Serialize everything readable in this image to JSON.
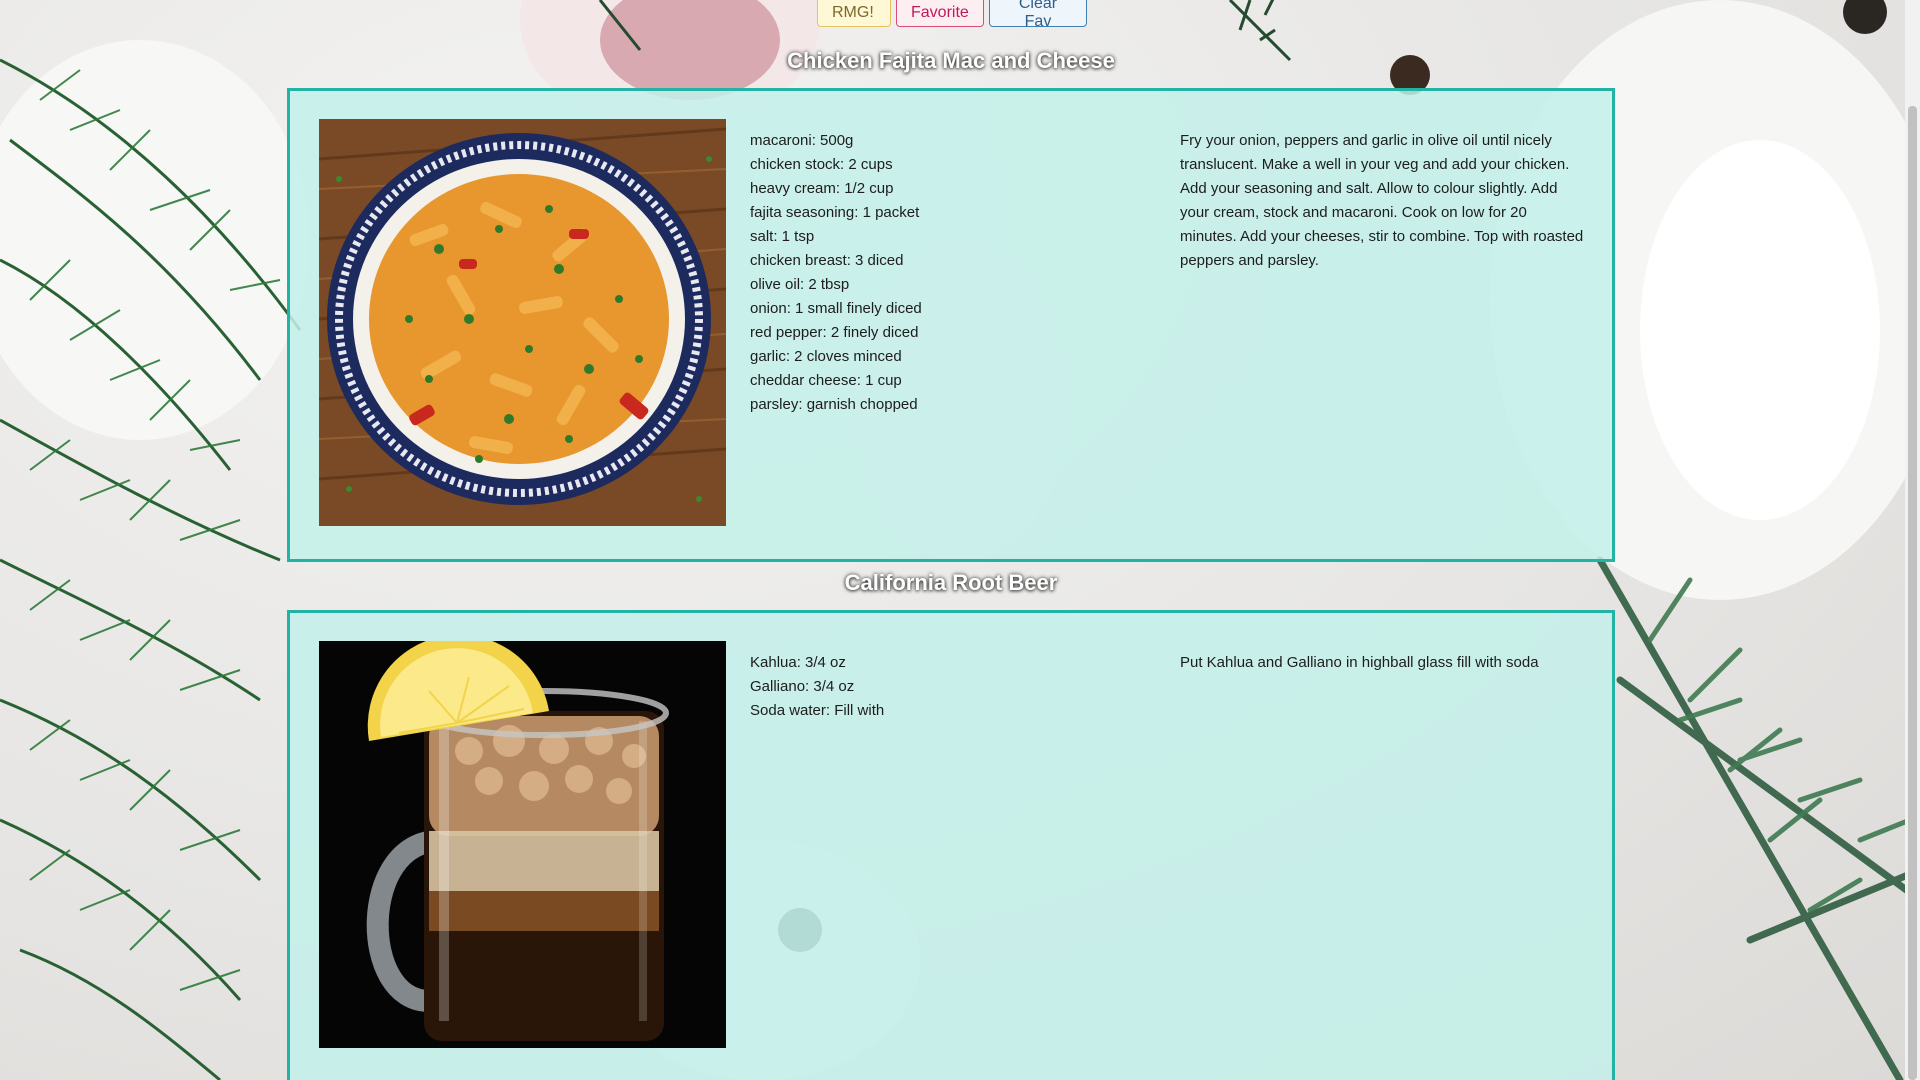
{
  "buttons": {
    "random_label": "RMG!",
    "favorite_label": "Favorite",
    "clear_fav_label": "Clear Fav"
  },
  "recipes": [
    {
      "title": "Chicken Fajita Mac and Cheese",
      "image_icon": "pasta-bowl-photo",
      "ingredients": [
        "macaroni: 500g",
        "chicken stock: 2 cups",
        "heavy cream: 1/2 cup",
        "fajita seasoning: 1 packet",
        "salt: 1 tsp",
        "chicken breast: 3 diced",
        "olive oil: 2 tbsp",
        "onion: 1 small finely diced",
        "red pepper: 2 finely diced",
        "garlic: 2 cloves minced",
        "cheddar cheese: 1 cup",
        "parsley: garnish chopped"
      ],
      "instructions": "Fry your onion, peppers and garlic in olive oil until nicely translucent. Make a well in your veg and add your chicken. Add your seasoning and salt. Allow to colour slightly. Add your cream, stock and macaroni. Cook on low for 20 minutes. Add your cheeses, stir to combine. Top with roasted peppers and parsley."
    },
    {
      "title": "California Root Beer",
      "image_icon": "root-beer-mug-photo",
      "ingredients": [
        "Kahlua: 3/4 oz",
        "Galliano: 3/4 oz",
        "Soda water: Fill with"
      ],
      "instructions": "Put Kahlua and Galliano in highball glass fill with soda"
    }
  ],
  "colors": {
    "card_border": "#22b3a4",
    "card_background": "#c4f0ea",
    "title_text": "#ffffff"
  }
}
